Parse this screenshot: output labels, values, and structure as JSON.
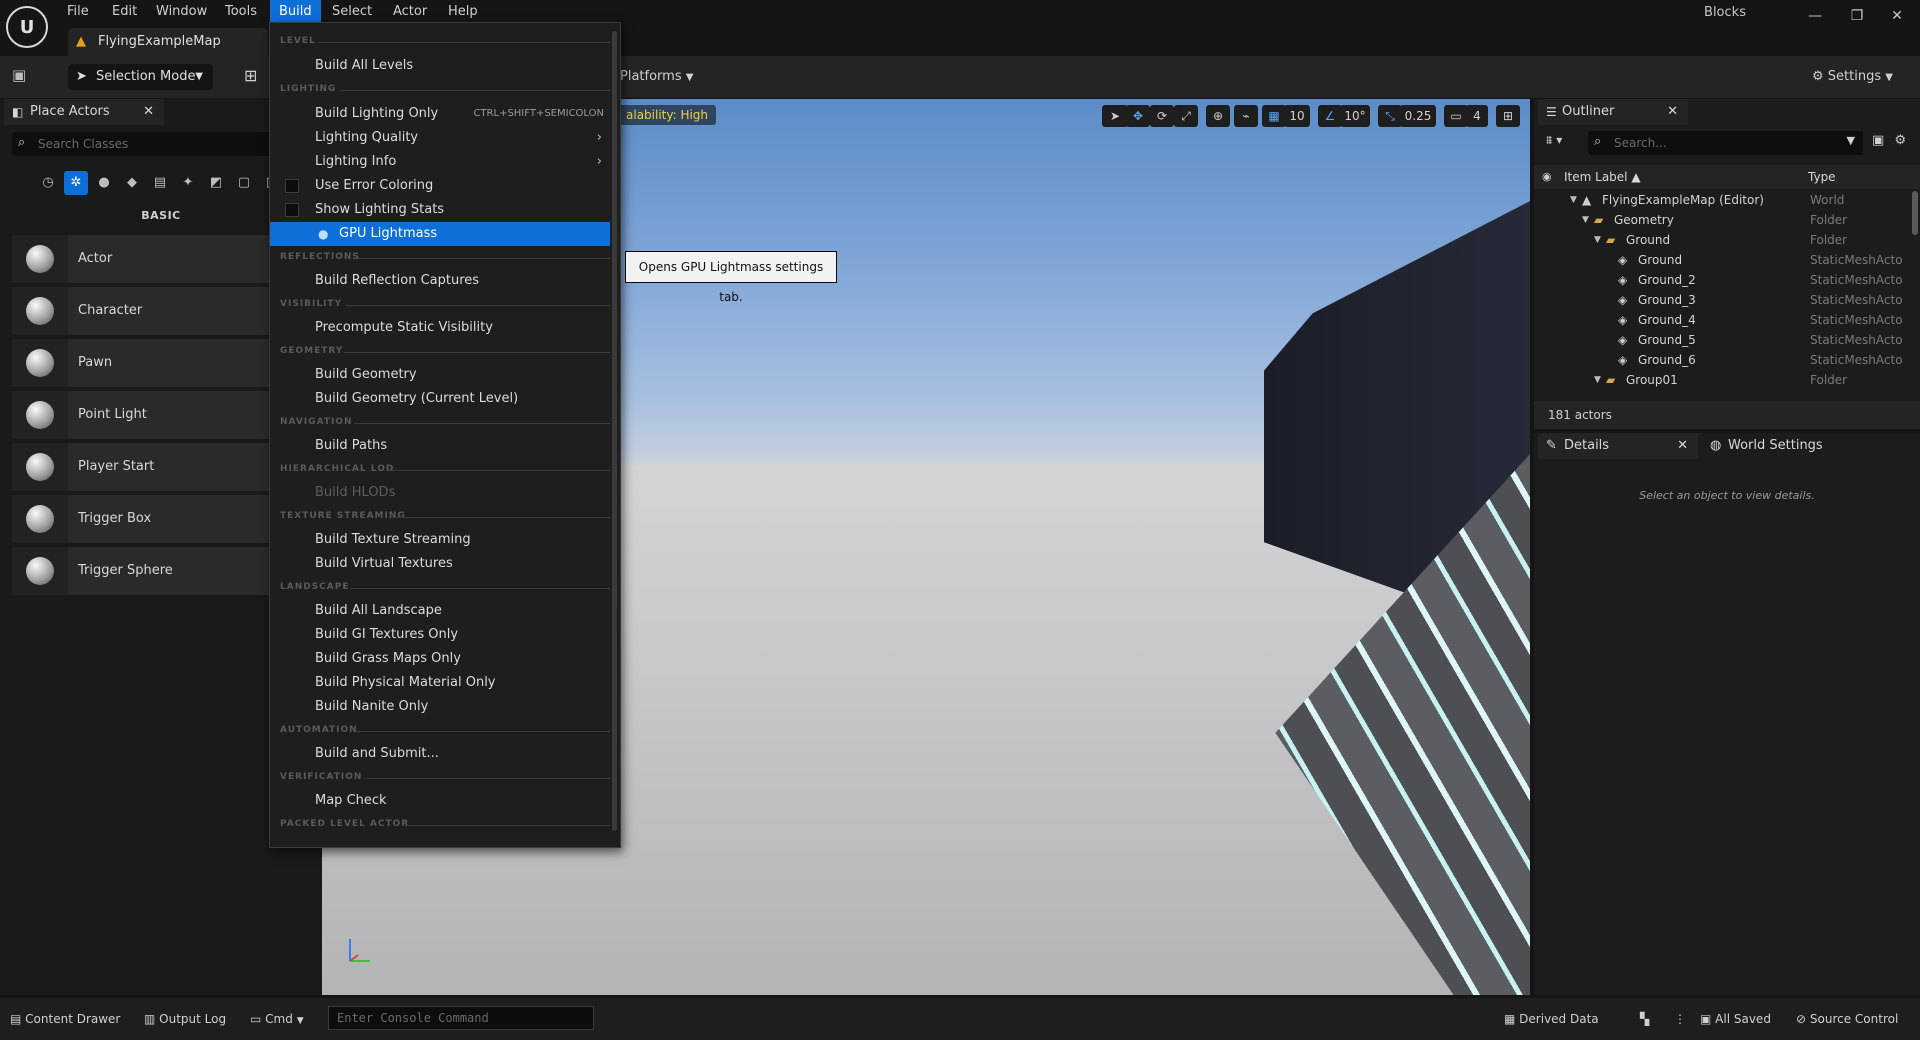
{
  "window": {
    "title": "Blocks",
    "minimize": "—",
    "restore": "❐",
    "close": "✕"
  },
  "menu": [
    "File",
    "Edit",
    "Window",
    "Tools",
    "Build",
    "Select",
    "Actor",
    "Help"
  ],
  "tab": {
    "label": "FlyingExampleMap"
  },
  "toolbar": {
    "mode": "Selection Mode",
    "platforms": "Platforms",
    "settings": "Settings"
  },
  "place_actors": {
    "tab_label": "Place Actors",
    "search_placeholder": "Search Classes",
    "section": "BASIC",
    "actors": [
      "Actor",
      "Character",
      "Pawn",
      "Point Light",
      "Player Start",
      "Trigger Box",
      "Trigger Sphere"
    ]
  },
  "viewport": {
    "scalability": "alability: High",
    "grid": "10",
    "angle": "10°",
    "scale": "0.25",
    "camera": "4"
  },
  "build_menu": {
    "sections": {
      "level": "LEVEL",
      "lighting": "LIGHTING",
      "reflections": "REFLECTIONS",
      "visibility": "VISIBILITY",
      "geometry": "GEOMETRY",
      "navigation": "NAVIGATION",
      "hlod": "HIERARCHICAL LOD",
      "texture": "TEXTURE STREAMING",
      "landscape": "LANDSCAPE",
      "automation": "AUTOMATION",
      "verification": "VERIFICATION",
      "packed": "PACKED LEVEL ACTOR"
    },
    "items": {
      "build_all_levels": "Build All Levels",
      "build_lighting_only": "Build Lighting Only",
      "build_lighting_shortcut": "CTRL+SHIFT+SEMICOLON",
      "lighting_quality": "Lighting Quality",
      "lighting_info": "Lighting Info",
      "use_error_coloring": "Use Error Coloring",
      "show_lighting_stats": "Show Lighting Stats",
      "gpu_lightmass": "GPU Lightmass",
      "build_reflection_captures": "Build Reflection Captures",
      "precompute_static_visibility": "Precompute Static Visibility",
      "build_geometry": "Build Geometry",
      "build_geometry_current": "Build Geometry (Current Level)",
      "build_paths": "Build Paths",
      "build_hlods": "Build HLODs",
      "build_texture_streaming": "Build Texture Streaming",
      "build_virtual_textures": "Build Virtual Textures",
      "build_all_landscape": "Build All Landscape",
      "build_gi_textures_only": "Build GI Textures Only",
      "build_grass_maps_only": "Build Grass Maps Only",
      "build_physical_material_only": "Build Physical Material Only",
      "build_nanite_only": "Build Nanite Only",
      "build_and_submit": "Build and Submit...",
      "map_check": "Map Check"
    }
  },
  "tooltip": "Opens GPU Lightmass settings tab.",
  "outliner": {
    "tab_label": "Outliner",
    "search_placeholder": "Search...",
    "col_label": "Item Label ▲",
    "col_type": "Type",
    "rows": [
      {
        "name": "FlyingExampleMap (Editor)",
        "type": "World"
      },
      {
        "name": "Geometry",
        "type": "Folder"
      },
      {
        "name": "Ground",
        "type": "Folder"
      },
      {
        "name": "Ground",
        "type": "StaticMeshActo"
      },
      {
        "name": "Ground_2",
        "type": "StaticMeshActo"
      },
      {
        "name": "Ground_3",
        "type": "StaticMeshActo"
      },
      {
        "name": "Ground_4",
        "type": "StaticMeshActo"
      },
      {
        "name": "Ground_5",
        "type": "StaticMeshActo"
      },
      {
        "name": "Ground_6",
        "type": "StaticMeshActo"
      },
      {
        "name": "Group01",
        "type": "Folder"
      }
    ],
    "count": "181 actors"
  },
  "details": {
    "tab_label": "Details",
    "world_settings": "World Settings",
    "empty_message": "Select an object to view details."
  },
  "statusbar": {
    "content_drawer": "Content Drawer",
    "output_log": "Output Log",
    "cmd": "Cmd",
    "console_placeholder": "Enter Console Command",
    "derived_data": "Derived Data",
    "all_saved": "All Saved",
    "source_control": "Source Control"
  }
}
